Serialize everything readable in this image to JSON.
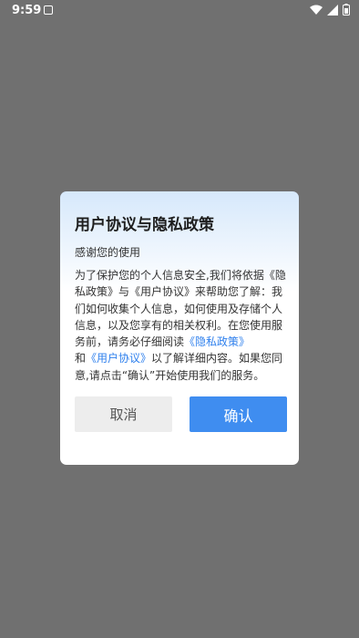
{
  "status_bar": {
    "time": "9:59",
    "icons": [
      "wifi-icon",
      "signal-icon",
      "battery-icon"
    ],
    "text_color": "#ffffff"
  },
  "dialog": {
    "title": "用户协议与隐私政策",
    "subtitle": "感谢您的使用",
    "body": {
      "part1": "为了保护您的个人信息安全,我们将依据《隐私政策》与《用户协议》来帮助您了解：我们如何收集个人信息，如何使用及存储个人信息，以及您享有的相关权利。在您使用服务前，请务必仔细阅读",
      "privacy_link": "《隐私政策》",
      "and": "和",
      "agreement_link": "《用户协议》",
      "part2": "以了解详细内容。如果您同意,请点击“确认”开始使用我们的服务。"
    },
    "cancel_label": "取消",
    "confirm_label": "确认"
  },
  "colors": {
    "overlay": "#707070",
    "link": "#2f80ed",
    "confirm_button": "#3f8df0",
    "cancel_button": "#ededed"
  }
}
